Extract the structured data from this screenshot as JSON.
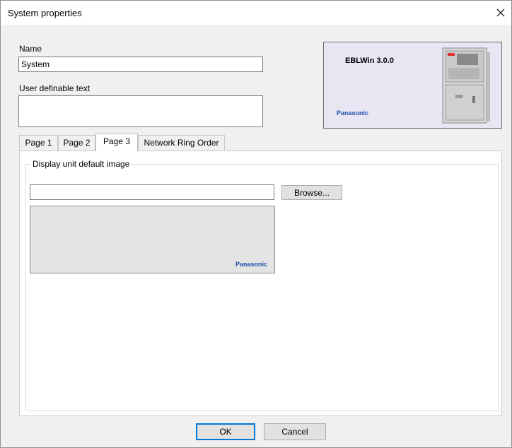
{
  "window": {
    "title": "System properties",
    "close_glyph": "✕"
  },
  "fields": {
    "name_label": "Name",
    "name_value": "System",
    "user_text_label": "User definable text",
    "user_text_value": ""
  },
  "logo": {
    "title": "EBLWin 3.0.0",
    "brand": "Panasonic"
  },
  "tabs": [
    {
      "label": "Page 1",
      "active": false
    },
    {
      "label": "Page 2",
      "active": false
    },
    {
      "label": "Page 3",
      "active": true
    },
    {
      "label": "Network Ring Order",
      "active": false
    }
  ],
  "page3": {
    "group_title": "Display unit default image",
    "image_path": "",
    "browse_label": "Browse...",
    "preview_brand": "Panasonic"
  },
  "footer": {
    "ok_label": "OK",
    "cancel_label": "Cancel"
  },
  "colors": {
    "brand_blue": "#1d4fa8",
    "default_button_border": "#0078d7"
  }
}
